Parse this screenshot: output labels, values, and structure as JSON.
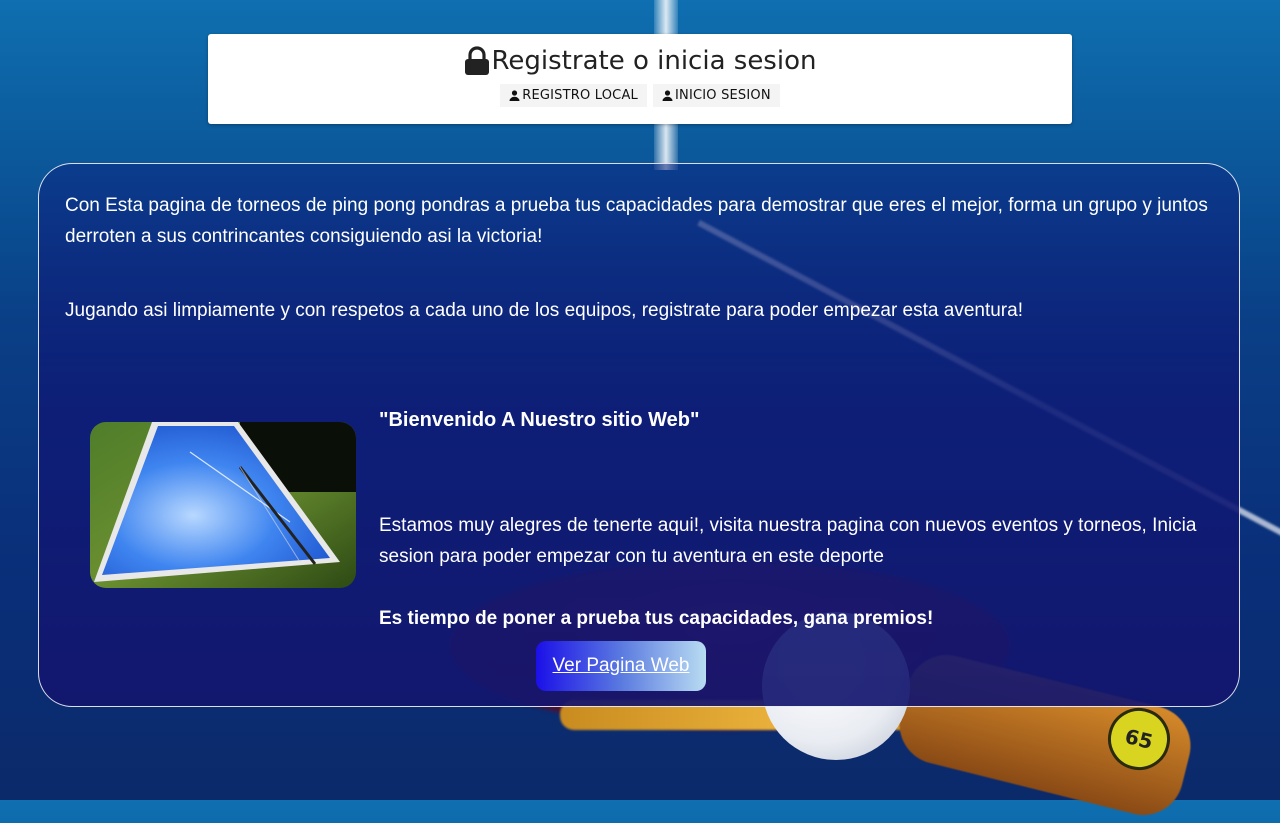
{
  "header": {
    "title": "Registrate o inicia sesion",
    "buttons": [
      {
        "label": "REGISTRO LOCAL",
        "icon": "user-icon"
      },
      {
        "label": "INICIO SESION",
        "icon": "user-icon"
      }
    ],
    "title_icon": "lock-icon"
  },
  "intro": {
    "paragraph1": "Con Esta pagina de torneos de ping pong pondras a prueba tus capacidades para demostrar que eres el mejor, forma un grupo y juntos derroten a sus contrincantes consiguiendo asi la victoria!",
    "paragraph2": "Jugando asi limpiamente y con respetos a cada uno de los equipos, registrate para poder empezar esta aventura!"
  },
  "welcome": {
    "title": "\"Bienvenido A Nuestro sitio Web\"",
    "text": "Estamos muy alegres de tenerte aqui!, visita nuestra pagina con nuevos eventos y torneos, Inicia sesion para poder empezar con tu aventura en este deporte",
    "challenge": "Es tiempo de poner a prueba tus capacidades, gana premios!",
    "cta_label": "Ver Pagina Web"
  },
  "background": {
    "paddle_badge": "65"
  },
  "colors": {
    "panel_border": "#ffffff",
    "cta_start": "#1b10e8",
    "cta_end": "#b9dcf2"
  }
}
